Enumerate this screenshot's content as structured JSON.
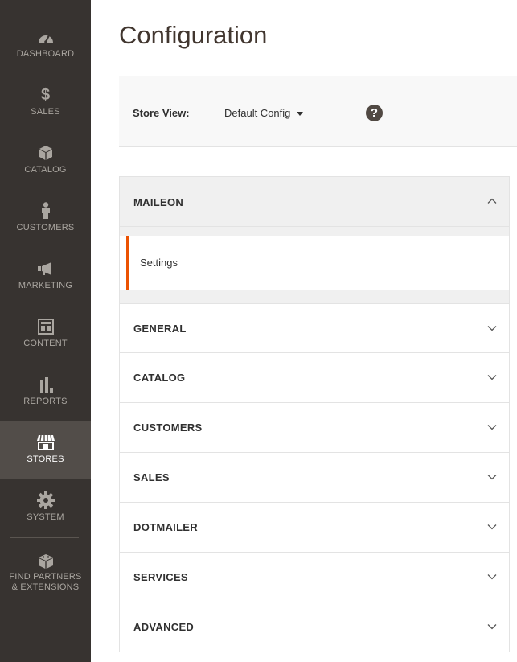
{
  "sidebar": {
    "items": [
      {
        "label": "DASHBOARD",
        "icon": "dashboard-icon"
      },
      {
        "label": "SALES",
        "icon": "dollar-icon"
      },
      {
        "label": "CATALOG",
        "icon": "box-icon"
      },
      {
        "label": "CUSTOMERS",
        "icon": "person-icon"
      },
      {
        "label": "MARKETING",
        "icon": "megaphone-icon"
      },
      {
        "label": "CONTENT",
        "icon": "layout-icon"
      },
      {
        "label": "REPORTS",
        "icon": "bar-chart-icon"
      },
      {
        "label": "STORES",
        "icon": "storefront-icon",
        "active": true
      },
      {
        "label": "SYSTEM",
        "icon": "gear-icon"
      },
      {
        "label_line1": "FIND PARTNERS",
        "label_line2": "& EXTENSIONS",
        "icon": "blocks-icon"
      }
    ]
  },
  "page": {
    "title": "Configuration"
  },
  "store_view": {
    "label": "Store View:",
    "selected": "Default Config",
    "help": "?"
  },
  "config_nav": {
    "expanded_section": {
      "title": "MAILEON",
      "sub_items": [
        {
          "label": "Settings",
          "active": true
        }
      ]
    },
    "sections": [
      {
        "title": "GENERAL"
      },
      {
        "title": "CATALOG"
      },
      {
        "title": "CUSTOMERS"
      },
      {
        "title": "SALES"
      },
      {
        "title": "DOTMAILER"
      },
      {
        "title": "SERVICES"
      },
      {
        "title": "ADVANCED"
      }
    ]
  },
  "colors": {
    "sidebar_bg": "#373330",
    "sidebar_active_bg": "#524d49",
    "accent": "#eb5202",
    "text_dark": "#303030"
  }
}
